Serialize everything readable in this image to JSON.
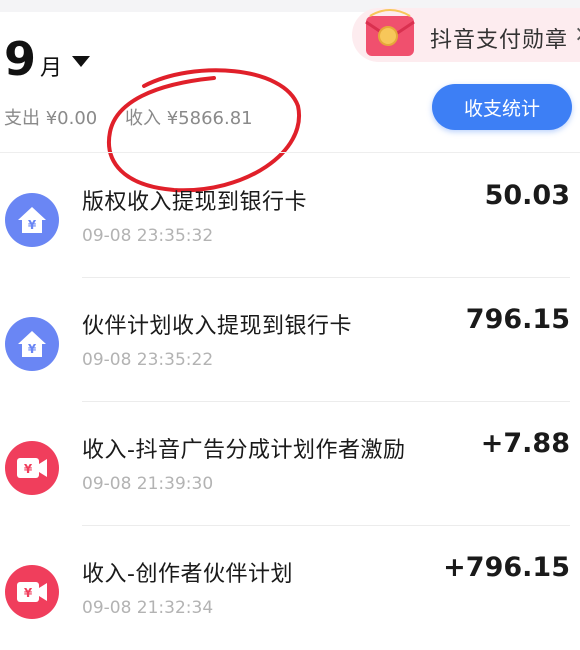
{
  "badge": {
    "text": "抖音支付勋章",
    "close": "×",
    "icon": "red-envelope-badge-icon"
  },
  "month": {
    "number": "9",
    "unit": "月",
    "caret": "dropdown-caret-icon"
  },
  "summary": {
    "expense": "支出 ¥0.00",
    "income": "收入 ¥5866.81"
  },
  "stats_button": {
    "label": "收支统计"
  },
  "colors": {
    "accent": "#3d7ff5",
    "withdraw_icon": "#6a86f4",
    "income_icon": "#f03e5c",
    "annotation": "#e0202a"
  },
  "transactions": [
    {
      "title": "版权收入提现到银行卡",
      "time": "09-08 23:35:32",
      "amount": "50.03",
      "icon": "withdraw-house-yen-icon"
    },
    {
      "title": "伙伴计划收入提现到银行卡",
      "time": "09-08 23:35:22",
      "amount": "796.15",
      "icon": "withdraw-house-yen-icon"
    },
    {
      "title": "收入-抖音广告分成计划作者激励",
      "time": "09-08 21:39:30",
      "amount": "+7.88",
      "icon": "income-video-yen-icon"
    },
    {
      "title": "收入-创作者伙伴计划",
      "time": "09-08 21:32:34",
      "amount": "+796.15",
      "icon": "income-video-yen-icon"
    }
  ]
}
